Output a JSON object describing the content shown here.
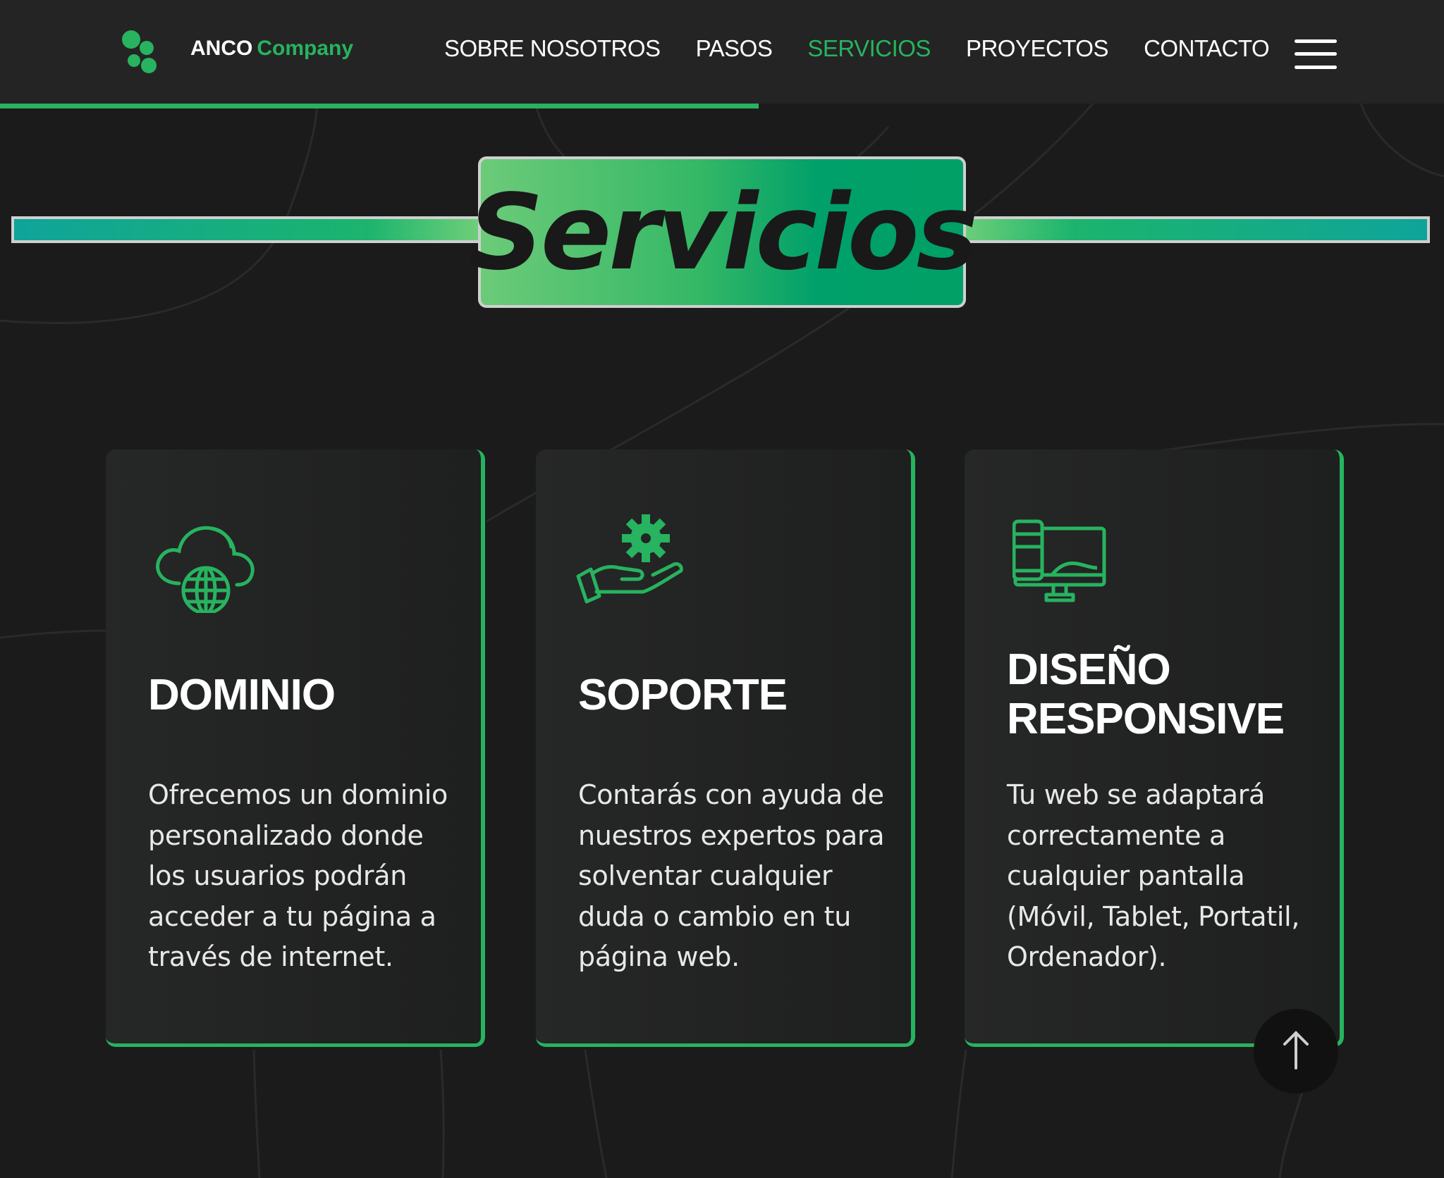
{
  "header": {
    "brand_main": "ANCO",
    "brand_accent": "Company",
    "nav": [
      {
        "label": "SOBRE NOSOTROS",
        "active": false
      },
      {
        "label": "PASOS",
        "active": false
      },
      {
        "label": "SERVICIOS",
        "active": true
      },
      {
        "label": "PROYECTOS",
        "active": false
      },
      {
        "label": "CONTACTO",
        "active": false
      }
    ],
    "menu_icon": "hamburger-icon"
  },
  "section": {
    "title": "Servicios"
  },
  "cards": [
    {
      "icon": "cloud-globe-icon",
      "title": "DOMINIO",
      "text": "Ofrecemos un dominio personalizado donde los usuarios podrán acceder a tu página a través de internet."
    },
    {
      "icon": "hand-gear-icon",
      "title": "SOPORTE",
      "text": "Contarás con ayuda de nuestros expertos para solventar cualquier duda o cambio en tu página web."
    },
    {
      "icon": "responsive-devices-icon",
      "title": "DISEÑO\nRESPONSIVE",
      "text": "Tu web se adaptará correctamente a cualquier pantalla (Móvil, Tablet, Portatil, Ordenador)."
    }
  ],
  "colors": {
    "accent": "#27b35f",
    "background": "#1b1b1b",
    "header": "#242424"
  },
  "scroll_top_icon": "arrow-up-icon"
}
